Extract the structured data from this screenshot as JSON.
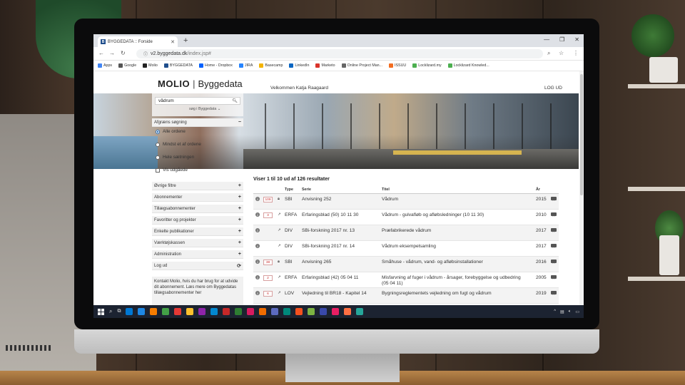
{
  "browser": {
    "tab_title": "BYGGEDATA :: Forside",
    "tab_favicon": "B",
    "new_tab": "+",
    "url_host": "v2.byggedata.dk",
    "url_path": "/index.jsp#",
    "bookmarks": [
      {
        "label": "Apps",
        "icon": "apps-icon",
        "color": "#4285f4"
      },
      {
        "label": "Google",
        "icon": "google-icon",
        "color": "#555555"
      },
      {
        "label": "Molio",
        "icon": "molio-icon",
        "color": "#222222"
      },
      {
        "label": "BYGGEDATA",
        "icon": "byggedata-icon",
        "color": "#1f4e8c"
      },
      {
        "label": "Home - Dropbox",
        "icon": "dropbox-icon",
        "color": "#0061fe"
      },
      {
        "label": "JIRA",
        "icon": "jira-icon",
        "color": "#2684ff"
      },
      {
        "label": "Basecamp",
        "icon": "basecamp-icon",
        "color": "#f4b400"
      },
      {
        "label": "LinkedIn",
        "icon": "linkedin-icon",
        "color": "#0a66c2"
      },
      {
        "label": "Marketo",
        "icon": "marketo-icon",
        "color": "#d9342b"
      },
      {
        "label": "Online Project Man...",
        "icon": "globe-icon",
        "color": "#666666"
      },
      {
        "label": "ISSUU",
        "icon": "issuu-icon",
        "color": "#f36d21"
      },
      {
        "label": "Locklizard.my",
        "icon": "locklizard-icon",
        "color": "#4caf50"
      },
      {
        "label": "Locklizard Knowled...",
        "icon": "locklizard-icon",
        "color": "#4caf50"
      }
    ]
  },
  "header": {
    "logo_brand": "MOLIO",
    "logo_sep": "|",
    "logo_product": "Byggedata",
    "welcome": "Velkommen Katja Raagaard",
    "logout": "LOG UD"
  },
  "sidebar": {
    "search_value": "vådrum",
    "search_scope": "søg i Byggedata",
    "refine_label": "Afgræns søgning",
    "refine_toggle": "−",
    "options": [
      {
        "label": "Alle ordene",
        "type": "radio",
        "checked": true
      },
      {
        "label": "Mindst et af ordene",
        "type": "radio",
        "checked": false
      },
      {
        "label": "Hele sætningen",
        "type": "radio",
        "checked": false
      },
      {
        "label": "Vis udgåede",
        "type": "checkbox",
        "checked": false
      }
    ],
    "sections": [
      {
        "label": "Øvrige filtre",
        "toggle": "+"
      },
      {
        "label": "Abonnementer",
        "toggle": "+"
      },
      {
        "label": "Tillægsabonnementer",
        "toggle": "+"
      },
      {
        "label": "Favoritter og projekter",
        "toggle": "+"
      },
      {
        "label": "Enkelte publikationer",
        "toggle": "+"
      },
      {
        "label": "Værktøjskassen",
        "toggle": "+"
      },
      {
        "label": "Administration",
        "toggle": "+"
      },
      {
        "label": "Log ud",
        "toggle": "⟳"
      }
    ],
    "info_text": "Kontakt Molio, hvis du har brug for at udvide dit abonnement. Læs mere om Byggedatas tillægsabonnementer her"
  },
  "results": {
    "summary": "Viser 1 til 10 ud af 126 resultater",
    "columns": {
      "type": "Type",
      "serie": "Serie",
      "titel": "Titel",
      "year": "År"
    },
    "rows": [
      {
        "badge": "109",
        "locked": true,
        "type": "SBI",
        "serie": "Anvisning 252",
        "titel": "Vådrum",
        "titel2": "",
        "year": "2015"
      },
      {
        "badge": "3",
        "locked": false,
        "type": "ERFA",
        "serie": "Erfaringsblad (50) 10 11 30",
        "titel": "Vådrum - gulvafløb og afløbsledninger (10 11 30)",
        "titel2": "",
        "year": "2010"
      },
      {
        "badge": "",
        "locked": false,
        "type": "DIV",
        "serie": "SBi-forskning 2017 nr. 13",
        "titel": "Præfabrikerede vådrum",
        "titel2": "",
        "year": "2017"
      },
      {
        "badge": "",
        "locked": false,
        "type": "DIV",
        "serie": "SBi-forskning 2017 nr. 14",
        "titel": "Vådrum eksempelsamling",
        "titel2": "",
        "year": "2017"
      },
      {
        "badge": "38",
        "locked": true,
        "type": "SBI",
        "serie": "Anvisning 265",
        "titel": "Småhuse - vådrum, vand- og afløbsinstallationer",
        "titel2": "",
        "year": "2016"
      },
      {
        "badge": "2",
        "locked": false,
        "type": "ERFA",
        "serie": "Erfaringsblad (42) 05 04 11",
        "titel": "Misfarvning af fuger i vådrum - årsager, forebyggelse og udbedring",
        "titel2": "(05 04 11)",
        "year": "2005"
      },
      {
        "badge": "6",
        "locked": false,
        "type": "LOV",
        "serie": "Vejledning til BR18 - Kapitel 14",
        "titel": "Bygningsreglementets vejledning om fugt og vådrum",
        "titel2": "",
        "year": "2019"
      }
    ]
  },
  "colors": {
    "accent": "#2b6cb0",
    "badge_red": "#cc3333",
    "taskbar": "#1c2331"
  }
}
